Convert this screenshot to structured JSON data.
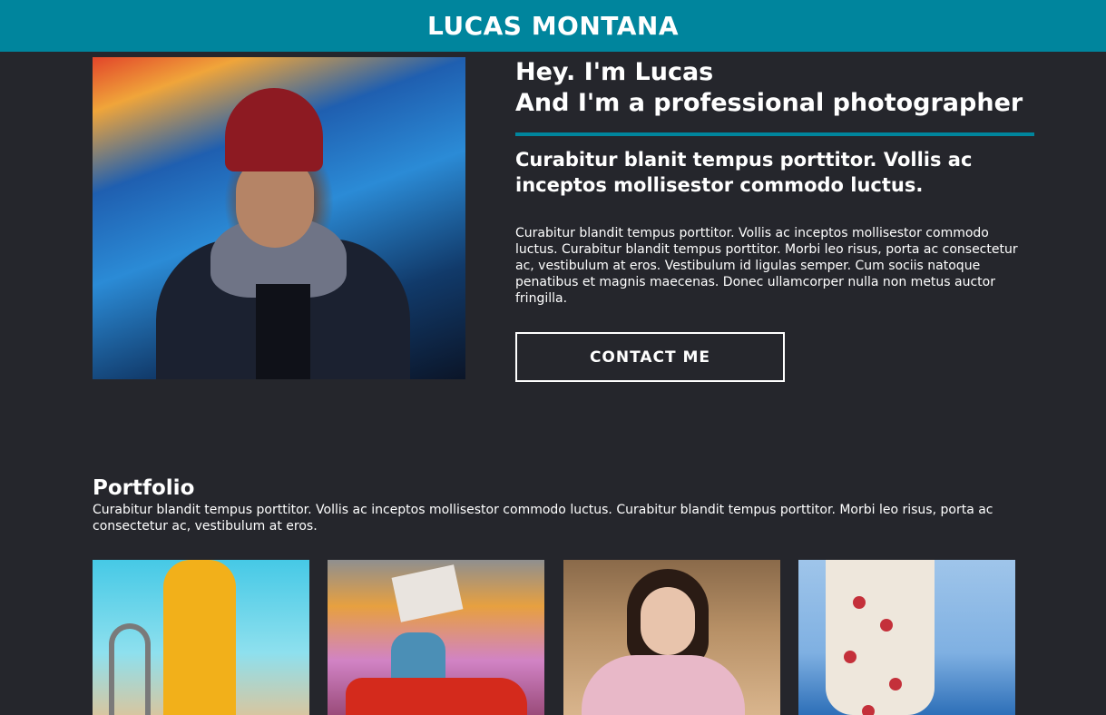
{
  "header": {
    "site_title": "LUCAS MONTANA"
  },
  "colors": {
    "accent": "#00859d",
    "background": "#25262c",
    "text": "#ffffff"
  },
  "hero": {
    "heading_line1": "Hey. I'm Lucas",
    "heading_line2": "And I'm a professional photographer",
    "subheading": "Curabitur blanit tempus porttitor. Vollis ac inceptos mollisestor commodo luctus.",
    "body": "Curabitur blandit tempus porttitor. Vollis ac inceptos mollisestor commodo luctus. Curabitur blandit tempus porttitor. Morbi leo risus, porta ac consectetur ac, vestibulum at eros. Vestibulum id ligulas semper. Cum sociis natoque penatibus et magnis maecenas. Donec ullamcorper nulla non metus auctor fringilla.",
    "contact_button_label": "CONTACT ME"
  },
  "portfolio": {
    "title": "Portfolio",
    "description": "Curabitur blandit tempus porttitor. Vollis ac inceptos mollisestor commodo luctus. Curabitur blandit tempus porttitor. Morbi leo risus, porta ac consectetur ac, vestibulum at eros."
  }
}
